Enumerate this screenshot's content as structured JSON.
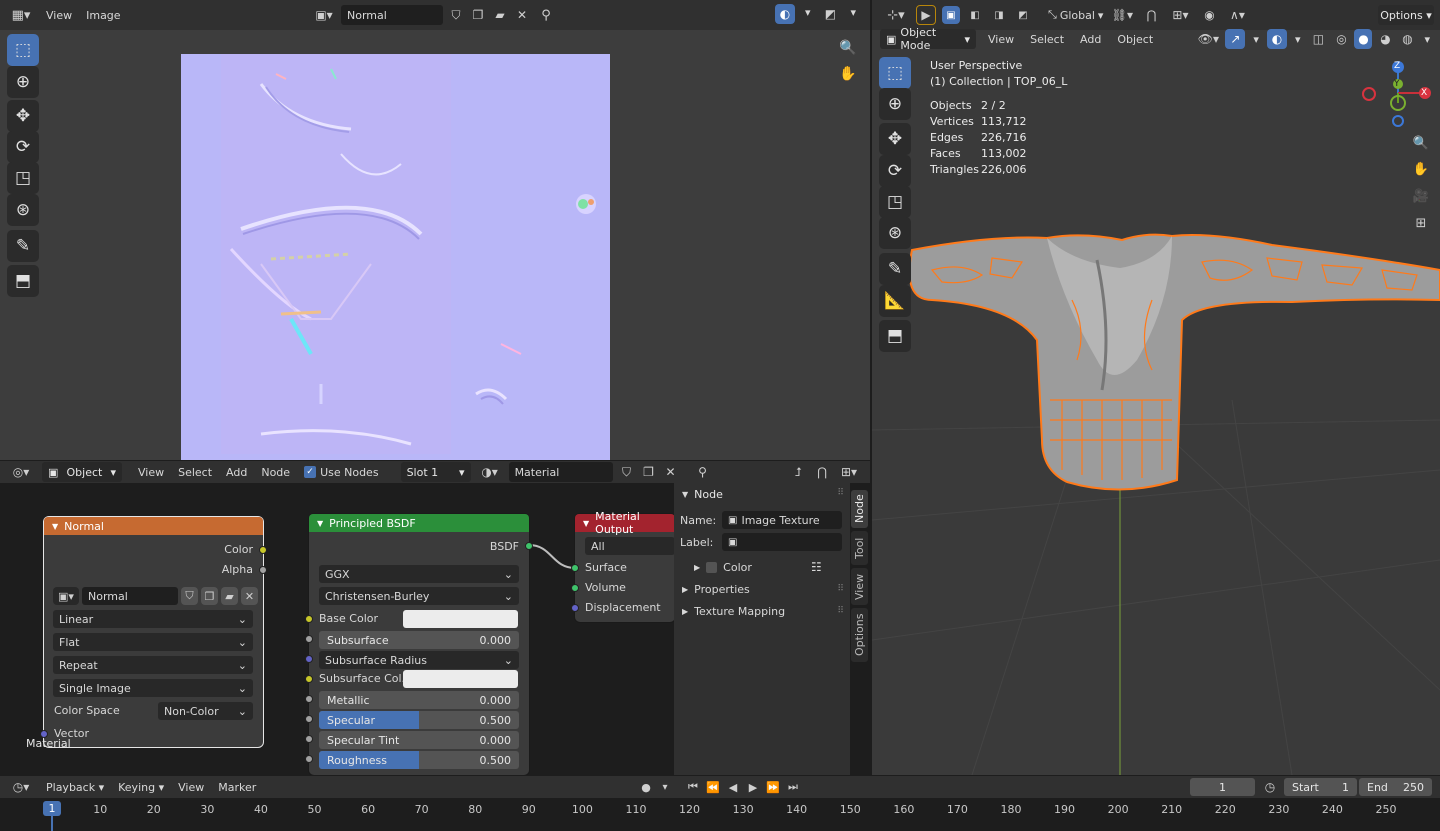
{
  "image_editor": {
    "menu": [
      "View",
      "Image"
    ],
    "image_name": "Normal"
  },
  "viewport": {
    "orientation": "Global",
    "options_label": "Options",
    "mode": "Object Mode",
    "menu": [
      "View",
      "Select",
      "Add",
      "Object"
    ],
    "perspective": "User Perspective",
    "collection": "(1) Collection | TOP_06_L",
    "stats": [
      {
        "label": "Objects",
        "value": "2 / 2"
      },
      {
        "label": "Vertices",
        "value": "113,712"
      },
      {
        "label": "Edges",
        "value": "226,716"
      },
      {
        "label": "Faces",
        "value": "113,002"
      },
      {
        "label": "Triangles",
        "value": "226,006"
      }
    ],
    "gizmo_axes": [
      "Z",
      "Y",
      "X"
    ]
  },
  "node_editor": {
    "object_type": "Object",
    "menu": [
      "View",
      "Select",
      "Add",
      "Node"
    ],
    "use_nodes_label": "Use Nodes",
    "use_nodes": true,
    "slot": "Slot 1",
    "material": "Material",
    "frame_label": "Material"
  },
  "image_node": {
    "title": "Normal",
    "out_color": "Color",
    "out_alpha": "Alpha",
    "image": "Normal",
    "interpolation": "Linear",
    "projection": "Flat",
    "extension": "Repeat",
    "source": "Single Image",
    "colorspace_label": "Color Space",
    "colorspace": "Non-Color",
    "in_vector": "Vector"
  },
  "bsdf_node": {
    "title": "Principled BSDF",
    "out": "BSDF",
    "distribution": "GGX",
    "subsurface_method": "Christensen-Burley",
    "inputs": [
      {
        "label": "Base Color",
        "kind": "color"
      },
      {
        "label": "Subsurface",
        "value": "0.000",
        "fill": 0
      },
      {
        "label": "Subsurface Radius",
        "kind": "dropdown"
      },
      {
        "label": "Subsurface Col...",
        "kind": "color"
      },
      {
        "label": "Metallic",
        "value": "0.000",
        "fill": 0
      },
      {
        "label": "Specular",
        "value": "0.500",
        "fill": 0.5
      },
      {
        "label": "Specular Tint",
        "value": "0.000",
        "fill": 0
      },
      {
        "label": "Roughness",
        "value": "0.500",
        "fill": 0.5
      }
    ]
  },
  "output_node": {
    "title": "Material Output",
    "target": "All",
    "inputs": [
      "Surface",
      "Volume",
      "Displacement"
    ]
  },
  "sidebar": {
    "section": "Node",
    "name_label": "Name:",
    "name_value": "Image Texture",
    "label_label": "Label:",
    "color_label": "Color",
    "properties_label": "Properties",
    "texture_mapping_label": "Texture Mapping",
    "tabs": [
      "Node",
      "Tool",
      "View",
      "Options"
    ]
  },
  "timeline": {
    "menu": [
      "Playback",
      "Keying",
      "View",
      "Marker"
    ],
    "current_frame": "1",
    "start_label": "Start",
    "start": "1",
    "end_label": "End",
    "end": "250",
    "ticks": [
      "1",
      "10",
      "20",
      "30",
      "40",
      "50",
      "60",
      "70",
      "80",
      "90",
      "100",
      "110",
      "120",
      "130",
      "140",
      "150",
      "160",
      "170",
      "180",
      "190",
      "200",
      "210",
      "220",
      "230",
      "240",
      "250"
    ]
  }
}
